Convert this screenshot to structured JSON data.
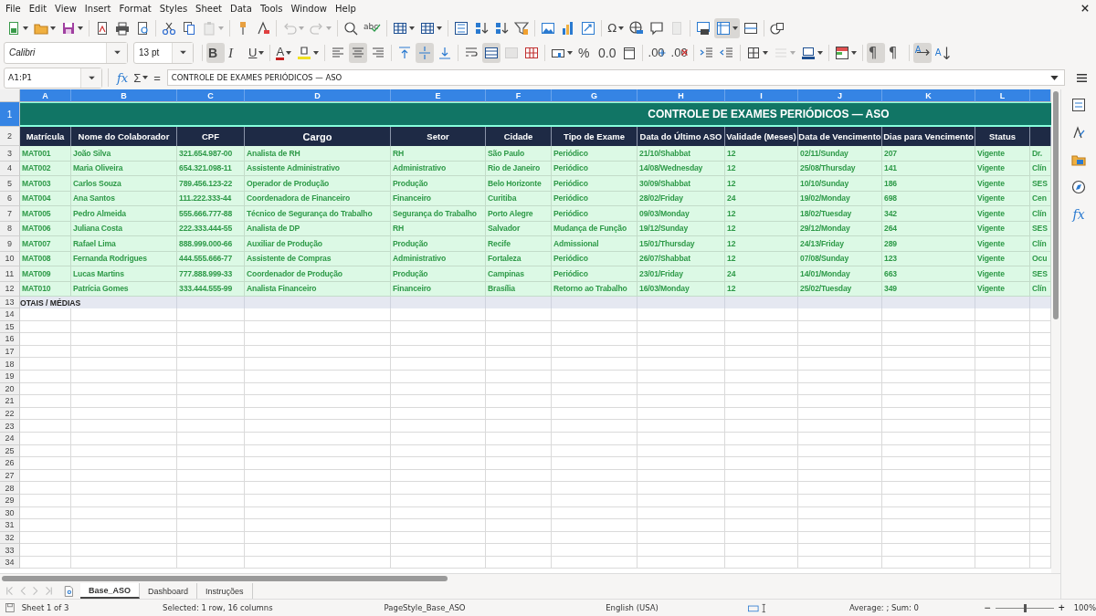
{
  "menu": [
    "File",
    "Edit",
    "View",
    "Insert",
    "Format",
    "Styles",
    "Sheet",
    "Data",
    "Tools",
    "Window",
    "Help"
  ],
  "toolbar_standard": [
    {
      "kind": "new",
      "dd": true
    },
    {
      "kind": "open",
      "dd": true
    },
    {
      "kind": "save",
      "dd": true
    },
    {
      "kind": "sep"
    },
    {
      "kind": "pdf"
    },
    {
      "kind": "print"
    },
    {
      "kind": "preview"
    },
    {
      "kind": "sep"
    },
    {
      "kind": "cut"
    },
    {
      "kind": "copy"
    },
    {
      "kind": "paste",
      "dd": true,
      "disabled": true
    },
    {
      "kind": "sep"
    },
    {
      "kind": "clone"
    },
    {
      "kind": "clear"
    },
    {
      "kind": "sep"
    },
    {
      "kind": "undo",
      "dd": true,
      "disabled": true
    },
    {
      "kind": "redo",
      "dd": true,
      "disabled": true
    },
    {
      "kind": "sep"
    },
    {
      "kind": "find"
    },
    {
      "kind": "spelling",
      "label": "abc"
    },
    {
      "kind": "sep"
    },
    {
      "kind": "row",
      "dd": true
    },
    {
      "kind": "column",
      "dd": true
    },
    {
      "kind": "sep"
    },
    {
      "kind": "sort"
    },
    {
      "kind": "sort_asc"
    },
    {
      "kind": "sort_desc"
    },
    {
      "kind": "filter"
    },
    {
      "kind": "sep"
    },
    {
      "kind": "image"
    },
    {
      "kind": "chart"
    },
    {
      "kind": "pivot"
    },
    {
      "kind": "sep"
    },
    {
      "kind": "special",
      "label": "Ω",
      "dd": true
    },
    {
      "kind": "hyperlink"
    },
    {
      "kind": "comment"
    },
    {
      "kind": "headerfooter",
      "disabled": true
    },
    {
      "kind": "sep"
    },
    {
      "kind": "printarea"
    },
    {
      "kind": "freeze",
      "dd": true,
      "on": true
    },
    {
      "kind": "split"
    },
    {
      "kind": "sep"
    },
    {
      "kind": "shapes"
    }
  ],
  "font_name": "Calibri",
  "font_size": "13 pt",
  "toolbar_formatting": [
    {
      "kind": "bold",
      "label": "B",
      "on": true
    },
    {
      "kind": "italic",
      "label": "I"
    },
    {
      "kind": "underline",
      "label": "U",
      "dd": true
    },
    {
      "kind": "sep"
    },
    {
      "kind": "fontcolor",
      "label": "A",
      "dd": true
    },
    {
      "kind": "highlight",
      "dd": true
    },
    {
      "kind": "sep"
    },
    {
      "kind": "align_left"
    },
    {
      "kind": "align_center",
      "on": true
    },
    {
      "kind": "align_right"
    },
    {
      "kind": "sep"
    },
    {
      "kind": "align_top"
    },
    {
      "kind": "align_vcenter",
      "on": true
    },
    {
      "kind": "align_bottom"
    },
    {
      "kind": "sep"
    },
    {
      "kind": "wrap"
    },
    {
      "kind": "merge_center",
      "on": true
    },
    {
      "kind": "merge",
      "disabled": true
    },
    {
      "kind": "unmerge"
    },
    {
      "kind": "sep"
    },
    {
      "kind": "currency",
      "dd": true
    },
    {
      "kind": "percent",
      "label": "%"
    },
    {
      "kind": "number",
      "label": "0.0"
    },
    {
      "kind": "date"
    },
    {
      "kind": "sep"
    },
    {
      "kind": "add_decimal",
      "label": ".00"
    },
    {
      "kind": "del_decimal",
      "label": ".00"
    },
    {
      "kind": "sep"
    },
    {
      "kind": "indent_inc"
    },
    {
      "kind": "indent_dec"
    },
    {
      "kind": "sep"
    },
    {
      "kind": "borders",
      "dd": true
    },
    {
      "kind": "border_style",
      "dd": true,
      "disabled": true
    },
    {
      "kind": "border_color",
      "dd": true
    },
    {
      "kind": "sep"
    },
    {
      "kind": "conditional",
      "dd": true
    },
    {
      "kind": "sep"
    },
    {
      "kind": "ltr",
      "label": "¶",
      "on": true
    },
    {
      "kind": "rtl",
      "label": "¶"
    },
    {
      "kind": "sep"
    },
    {
      "kind": "text_horizontal",
      "label": "A",
      "on": true
    },
    {
      "kind": "text_vertical",
      "label": "A"
    }
  ],
  "formula_bar": {
    "name_box": "A1:P1",
    "fx": "fx",
    "sum": "Σ",
    "equals": "=",
    "content": "CONTROLE DE EXAMES PERIÓDICOS — ASO"
  },
  "sheet": {
    "column_letters": [
      {
        "label": "A",
        "selected": true
      },
      {
        "label": "B",
        "selected": true
      },
      {
        "label": "C",
        "selected": true
      },
      {
        "label": "D",
        "selected": true
      },
      {
        "label": "E",
        "selected": true
      },
      {
        "label": "F",
        "selected": true
      },
      {
        "label": "G",
        "selected": true
      },
      {
        "label": "H",
        "selected": true
      },
      {
        "label": "I",
        "selected": true
      },
      {
        "label": "J",
        "selected": true
      },
      {
        "label": "K",
        "selected": true
      },
      {
        "label": "L",
        "selected": true
      }
    ],
    "title_row": {
      "number": "1",
      "selected": true,
      "title": "CONTROLE DE EXAMES PERIÓDICOS — ASO"
    },
    "header_row": {
      "number": "2",
      "selected": false,
      "headers": [
        "Matrícula",
        "Nome do Colaborador",
        "CPF",
        "Cargo",
        "Setor",
        "Cidade",
        "Tipo de Exame",
        "Data do Último ASO",
        "Validade (Meses)",
        "Data de Vencimento",
        "Dias para Vencimento",
        "Status"
      ]
    },
    "rows": [
      {
        "number": "3",
        "cells": [
          "MAT001",
          "João Silva",
          "321.654.987-00",
          "Analista de RH",
          "RH",
          "São Paulo",
          "Periódico",
          "21/10/Shabbat",
          "12",
          "02/11/Sunday",
          "207",
          "Vigente",
          "Dr."
        ]
      },
      {
        "number": "4",
        "cells": [
          "MAT002",
          "Maria Oliveira",
          "654.321.098-11",
          "Assistente Administrativo",
          "Administrativo",
          "Rio de Janeiro",
          "Periódico",
          "14/08/Wednesday",
          "12",
          "25/08/Thursday",
          "141",
          "Vigente",
          "Clín"
        ]
      },
      {
        "number": "5",
        "cells": [
          "MAT003",
          "Carlos Souza",
          "789.456.123-22",
          "Operador de Produção",
          "Produção",
          "Belo Horizonte",
          "Periódico",
          "30/09/Shabbat",
          "12",
          "10/10/Sunday",
          "186",
          "Vigente",
          "SES"
        ]
      },
      {
        "number": "6",
        "cells": [
          "MAT004",
          "Ana Santos",
          "111.222.333-44",
          "Coordenadora de Financeiro",
          "Financeiro",
          "Curitiba",
          "Periódico",
          "28/02/Friday",
          "24",
          "19/02/Monday",
          "698",
          "Vigente",
          "Cen"
        ]
      },
      {
        "number": "7",
        "cells": [
          "MAT005",
          "Pedro Almeida",
          "555.666.777-88",
          "Técnico de Segurança do Trabalho",
          "Segurança do Trabalho",
          "Porto Alegre",
          "Periódico",
          "09/03/Monday",
          "12",
          "18/02/Tuesday",
          "342",
          "Vigente",
          "Clín"
        ]
      },
      {
        "number": "8",
        "cells": [
          "MAT006",
          "Juliana Costa",
          "222.333.444-55",
          "Analista de DP",
          "RH",
          "Salvador",
          "Mudança de Função",
          "19/12/Sunday",
          "12",
          "29/12/Monday",
          "264",
          "Vigente",
          "SES"
        ]
      },
      {
        "number": "9",
        "cells": [
          "MAT007",
          "Rafael Lima",
          "888.999.000-66",
          "Auxiliar de Produção",
          "Produção",
          "Recife",
          "Admissional",
          "15/01/Thursday",
          "12",
          "24/13/Friday",
          "289",
          "Vigente",
          "Clín"
        ]
      },
      {
        "number": "10",
        "cells": [
          "MAT008",
          "Fernanda Rodrigues",
          "444.555.666-77",
          "Assistente de Compras",
          "Administrativo",
          "Fortaleza",
          "Periódico",
          "26/07/Shabbat",
          "12",
          "07/08/Sunday",
          "123",
          "Vigente",
          "Ocu"
        ]
      },
      {
        "number": "11",
        "cells": [
          "MAT009",
          "Lucas Martins",
          "777.888.999-33",
          "Coordenador de Produção",
          "Produção",
          "Campinas",
          "Periódico",
          "23/01/Friday",
          "24",
          "14/01/Monday",
          "663",
          "Vigente",
          "SES"
        ]
      },
      {
        "number": "12",
        "cells": [
          "MAT010",
          "Patrícia Gomes",
          "333.444.555-99",
          "Analista Financeiro",
          "Financeiro",
          "Brasília",
          "Retorno ao Trabalho",
          "16/03/Monday",
          "12",
          "25/02/Tuesday",
          "349",
          "Vigente",
          "Clín"
        ]
      }
    ],
    "totals_row": {
      "number": "13",
      "label": "OTAIS / MÉDIAS"
    },
    "empty_row_numbers": [
      "14",
      "15",
      "16",
      "17",
      "18",
      "19",
      "20",
      "21",
      "22",
      "23",
      "24",
      "25",
      "26",
      "27",
      "28",
      "29",
      "30",
      "31",
      "32",
      "33",
      "34"
    ]
  },
  "sheet_tabs": [
    {
      "label": "Base_ASO",
      "selected": true
    },
    {
      "label": "Dashboard",
      "selected": false
    },
    {
      "label": "Instruções",
      "selected": false
    }
  ],
  "status_bar": {
    "sheet": "Sheet 1 of 3",
    "selection": "Selected: 1 row, 16 columns",
    "page_style": "PageStyle_Base_ASO",
    "language": "English (USA)",
    "summary": "Average: ; Sum: 0",
    "zoom_out": "−",
    "zoom_in": "+",
    "zoom": {
      "level": 0.5
    },
    "zoom_percent": "100%"
  },
  "sidebar": [
    {
      "kind": "properties"
    },
    {
      "kind": "styles"
    },
    {
      "kind": "gallery"
    },
    {
      "kind": "navigator"
    },
    {
      "kind": "functions",
      "label": "fx"
    }
  ]
}
